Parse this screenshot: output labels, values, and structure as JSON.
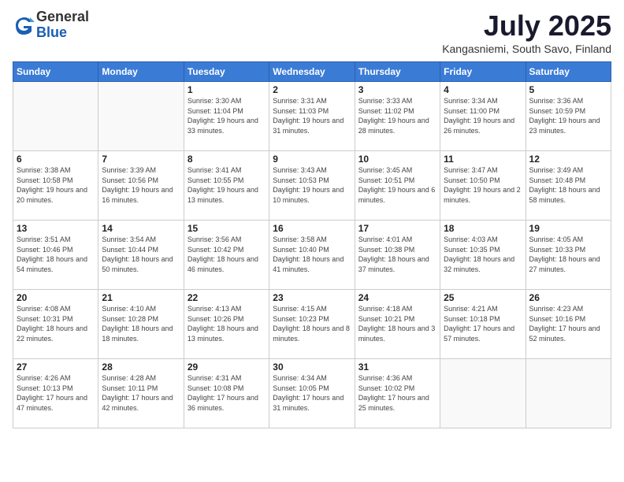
{
  "logo": {
    "general": "General",
    "blue": "Blue"
  },
  "title": "July 2025",
  "location": "Kangasniemi, South Savo, Finland",
  "days_of_week": [
    "Sunday",
    "Monday",
    "Tuesday",
    "Wednesday",
    "Thursday",
    "Friday",
    "Saturday"
  ],
  "weeks": [
    [
      {
        "day": "",
        "info": ""
      },
      {
        "day": "",
        "info": ""
      },
      {
        "day": "1",
        "info": "Sunrise: 3:30 AM\nSunset: 11:04 PM\nDaylight: 19 hours and 33 minutes."
      },
      {
        "day": "2",
        "info": "Sunrise: 3:31 AM\nSunset: 11:03 PM\nDaylight: 19 hours and 31 minutes."
      },
      {
        "day": "3",
        "info": "Sunrise: 3:33 AM\nSunset: 11:02 PM\nDaylight: 19 hours and 28 minutes."
      },
      {
        "day": "4",
        "info": "Sunrise: 3:34 AM\nSunset: 11:00 PM\nDaylight: 19 hours and 26 minutes."
      },
      {
        "day": "5",
        "info": "Sunrise: 3:36 AM\nSunset: 10:59 PM\nDaylight: 19 hours and 23 minutes."
      }
    ],
    [
      {
        "day": "6",
        "info": "Sunrise: 3:38 AM\nSunset: 10:58 PM\nDaylight: 19 hours and 20 minutes."
      },
      {
        "day": "7",
        "info": "Sunrise: 3:39 AM\nSunset: 10:56 PM\nDaylight: 19 hours and 16 minutes."
      },
      {
        "day": "8",
        "info": "Sunrise: 3:41 AM\nSunset: 10:55 PM\nDaylight: 19 hours and 13 minutes."
      },
      {
        "day": "9",
        "info": "Sunrise: 3:43 AM\nSunset: 10:53 PM\nDaylight: 19 hours and 10 minutes."
      },
      {
        "day": "10",
        "info": "Sunrise: 3:45 AM\nSunset: 10:51 PM\nDaylight: 19 hours and 6 minutes."
      },
      {
        "day": "11",
        "info": "Sunrise: 3:47 AM\nSunset: 10:50 PM\nDaylight: 19 hours and 2 minutes."
      },
      {
        "day": "12",
        "info": "Sunrise: 3:49 AM\nSunset: 10:48 PM\nDaylight: 18 hours and 58 minutes."
      }
    ],
    [
      {
        "day": "13",
        "info": "Sunrise: 3:51 AM\nSunset: 10:46 PM\nDaylight: 18 hours and 54 minutes."
      },
      {
        "day": "14",
        "info": "Sunrise: 3:54 AM\nSunset: 10:44 PM\nDaylight: 18 hours and 50 minutes."
      },
      {
        "day": "15",
        "info": "Sunrise: 3:56 AM\nSunset: 10:42 PM\nDaylight: 18 hours and 46 minutes."
      },
      {
        "day": "16",
        "info": "Sunrise: 3:58 AM\nSunset: 10:40 PM\nDaylight: 18 hours and 41 minutes."
      },
      {
        "day": "17",
        "info": "Sunrise: 4:01 AM\nSunset: 10:38 PM\nDaylight: 18 hours and 37 minutes."
      },
      {
        "day": "18",
        "info": "Sunrise: 4:03 AM\nSunset: 10:35 PM\nDaylight: 18 hours and 32 minutes."
      },
      {
        "day": "19",
        "info": "Sunrise: 4:05 AM\nSunset: 10:33 PM\nDaylight: 18 hours and 27 minutes."
      }
    ],
    [
      {
        "day": "20",
        "info": "Sunrise: 4:08 AM\nSunset: 10:31 PM\nDaylight: 18 hours and 22 minutes."
      },
      {
        "day": "21",
        "info": "Sunrise: 4:10 AM\nSunset: 10:28 PM\nDaylight: 18 hours and 18 minutes."
      },
      {
        "day": "22",
        "info": "Sunrise: 4:13 AM\nSunset: 10:26 PM\nDaylight: 18 hours and 13 minutes."
      },
      {
        "day": "23",
        "info": "Sunrise: 4:15 AM\nSunset: 10:23 PM\nDaylight: 18 hours and 8 minutes."
      },
      {
        "day": "24",
        "info": "Sunrise: 4:18 AM\nSunset: 10:21 PM\nDaylight: 18 hours and 3 minutes."
      },
      {
        "day": "25",
        "info": "Sunrise: 4:21 AM\nSunset: 10:18 PM\nDaylight: 17 hours and 57 minutes."
      },
      {
        "day": "26",
        "info": "Sunrise: 4:23 AM\nSunset: 10:16 PM\nDaylight: 17 hours and 52 minutes."
      }
    ],
    [
      {
        "day": "27",
        "info": "Sunrise: 4:26 AM\nSunset: 10:13 PM\nDaylight: 17 hours and 47 minutes."
      },
      {
        "day": "28",
        "info": "Sunrise: 4:28 AM\nSunset: 10:11 PM\nDaylight: 17 hours and 42 minutes."
      },
      {
        "day": "29",
        "info": "Sunrise: 4:31 AM\nSunset: 10:08 PM\nDaylight: 17 hours and 36 minutes."
      },
      {
        "day": "30",
        "info": "Sunrise: 4:34 AM\nSunset: 10:05 PM\nDaylight: 17 hours and 31 minutes."
      },
      {
        "day": "31",
        "info": "Sunrise: 4:36 AM\nSunset: 10:02 PM\nDaylight: 17 hours and 25 minutes."
      },
      {
        "day": "",
        "info": ""
      },
      {
        "day": "",
        "info": ""
      }
    ]
  ]
}
